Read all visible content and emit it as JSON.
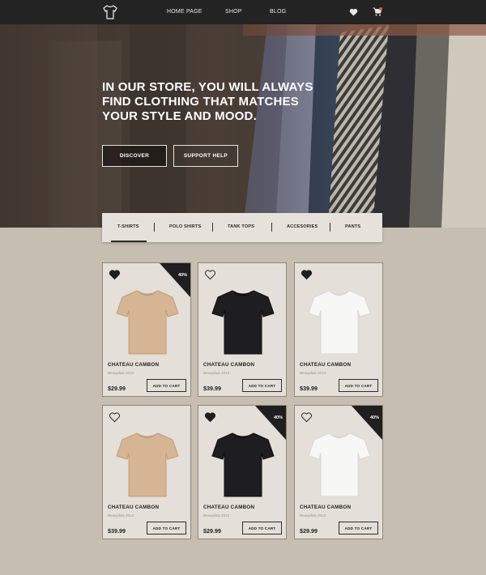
{
  "header": {
    "nav": [
      {
        "label": "HOME PAGE"
      },
      {
        "label": "SHOP"
      },
      {
        "label": "BLOG"
      }
    ]
  },
  "hero": {
    "headline": "IN OUR STORE, YOU WILL ALWAYS FIND CLOTHING THAT MATCHES YOUR STYLE AND MOOD.",
    "discover_label": "DISCOVER",
    "support_label": "SUPPORT HELP"
  },
  "tabs": {
    "active_index": 0,
    "items": [
      {
        "label": "T-SHIRTS"
      },
      {
        "label": "POLO SHIRTS"
      },
      {
        "label": "TANK TOPS"
      },
      {
        "label": "ACCESORIES"
      },
      {
        "label": "PANTS"
      }
    ]
  },
  "colors": {
    "page_bg": "#c6bfb1",
    "header_bg": "#232323",
    "card_bg": "#e4dfd8",
    "cart_dot": "#e05a4f"
  },
  "products": [
    {
      "name": "CHATEAU CAMBON",
      "subtitle": "Beaujolais 2013",
      "price": "$29.99",
      "cart_label": "ADD TO CART",
      "favorited": true,
      "discount": "40%",
      "shirt_color": "beige"
    },
    {
      "name": "CHATEAU CAMBON",
      "subtitle": "Beaujolais 2013",
      "price": "$39.99",
      "cart_label": "ADD TO CART",
      "favorited": false,
      "discount": "",
      "shirt_color": "black"
    },
    {
      "name": "CHATEAU CAMBON",
      "subtitle": "Beaujolais 2013",
      "price": "$39.99",
      "cart_label": "ADD TO CART",
      "favorited": true,
      "discount": "",
      "shirt_color": "white"
    },
    {
      "name": "CHATEAU CAMBON",
      "subtitle": "Beaujolais 2013",
      "price": "$39.99",
      "cart_label": "ADD TO CART",
      "favorited": false,
      "discount": "",
      "shirt_color": "beige"
    },
    {
      "name": "CHATEAU CAMBON",
      "subtitle": "Beaujolais 2013",
      "price": "$29.99",
      "cart_label": "ADD TO CART",
      "favorited": true,
      "discount": "40%",
      "shirt_color": "black"
    },
    {
      "name": "CHATEAU CAMBON",
      "subtitle": "Beaujolais 2013",
      "price": "$29.99",
      "cart_label": "ADD TO CART",
      "favorited": false,
      "discount": "40%",
      "shirt_color": "white"
    }
  ]
}
